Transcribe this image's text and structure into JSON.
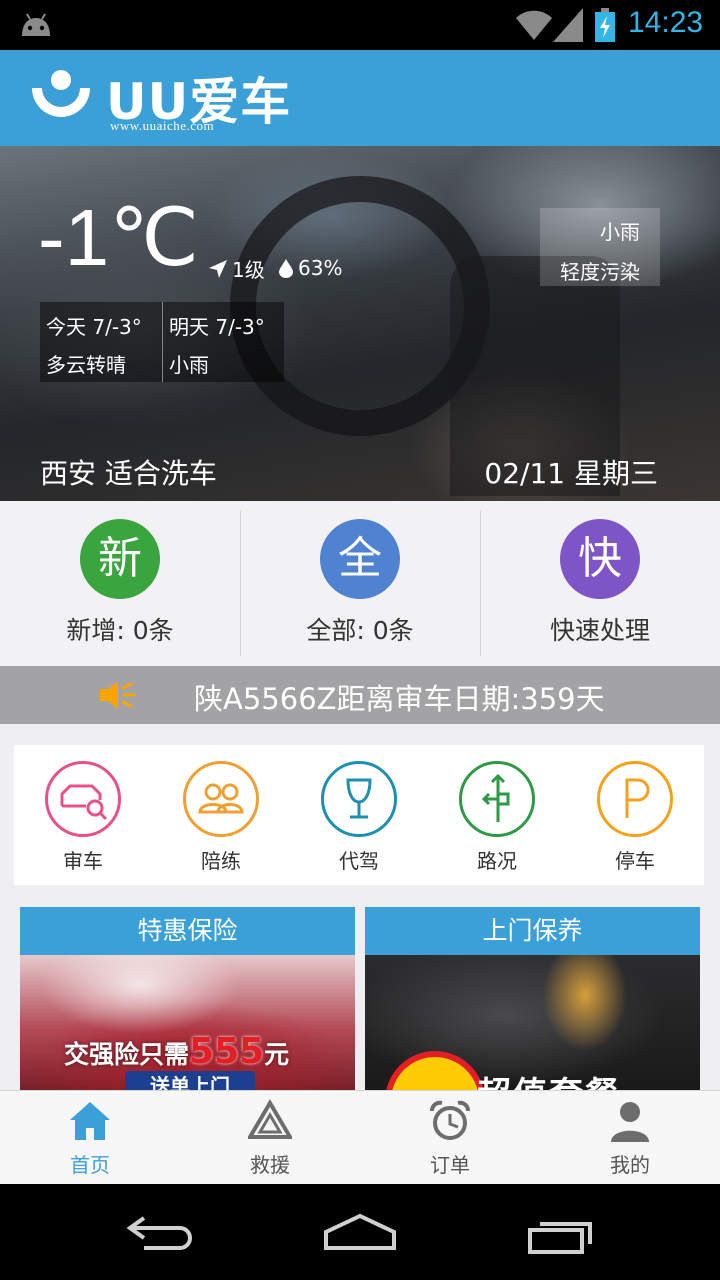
{
  "status_bar": {
    "time": "14:23"
  },
  "header": {
    "logo_text": "UU爱车",
    "logo_url": "www.uuaiche.com"
  },
  "weather": {
    "temperature": "-1℃",
    "wind": "1级",
    "humidity": "63%",
    "condition": "小雨",
    "air_quality": "轻度污染",
    "forecast": [
      {
        "day_temp": "今天  7/-3°",
        "desc": "多云转晴"
      },
      {
        "day_temp": "明天  7/-3°",
        "desc": "小雨"
      }
    ],
    "location": "西安  适合洗车",
    "date": "02/11  星期三"
  },
  "stats": [
    {
      "glyph": "新",
      "label": "新增: 0条",
      "color": "#3aa53e"
    },
    {
      "glyph": "全",
      "label": "全部: 0条",
      "color": "#4f82d1"
    },
    {
      "glyph": "快",
      "label": "快速处理",
      "color": "#7e55c7"
    }
  ],
  "notice": {
    "text": "陕A5566Z距离审车日期:359天"
  },
  "services": [
    {
      "label": "审车",
      "color": "#e8508a",
      "icon": "car-search-icon"
    },
    {
      "label": "陪练",
      "color": "#f0a030",
      "icon": "people-icon"
    },
    {
      "label": "代驾",
      "color": "#1d8fb0",
      "icon": "wine-glass-icon"
    },
    {
      "label": "路况",
      "color": "#2e9a46",
      "icon": "road-sign-icon"
    },
    {
      "label": "停车",
      "color": "#f3a21c",
      "icon": "parking-icon"
    }
  ],
  "promos": [
    {
      "title": "特惠保险",
      "text_a": "交强险只需",
      "price": "555",
      "text_b": "元",
      "tag": "送单上门"
    },
    {
      "title": "上门保养",
      "big_text": "超值套餐"
    }
  ],
  "bottom_nav": [
    {
      "label": "首页",
      "icon": "home-icon",
      "active": true
    },
    {
      "label": "救援",
      "icon": "warning-triangle-icon",
      "active": false
    },
    {
      "label": "订单",
      "icon": "alarm-clock-icon",
      "active": false
    },
    {
      "label": "我的",
      "icon": "user-icon",
      "active": false
    }
  ],
  "colors": {
    "brand": "#3ca0d8",
    "notice_bg": "#a3a3a5"
  }
}
